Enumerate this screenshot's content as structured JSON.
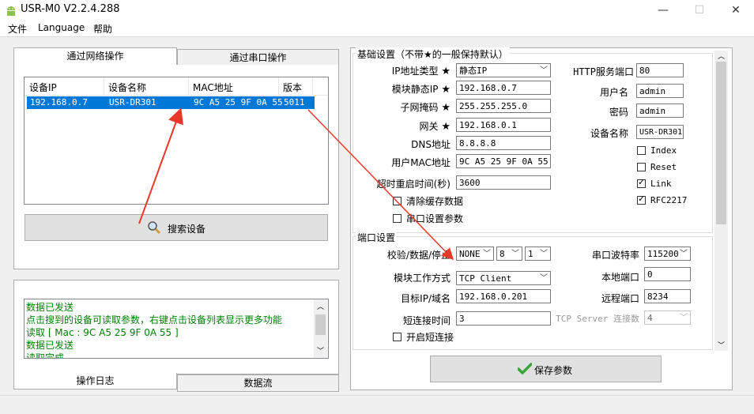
{
  "window": {
    "title": "USR-M0 V2.2.4.288",
    "icon": "android-robot-icon",
    "controls": [
      "minimize-icon",
      "maximize-icon",
      "close-icon"
    ]
  },
  "menu": {
    "items": [
      "文件",
      "Language",
      "帮助"
    ]
  },
  "left": {
    "tabs": {
      "network": "通过网络操作",
      "serial": "通过串口操作"
    },
    "table": {
      "headers": [
        "设备IP",
        "设备名称",
        "MAC地址",
        "版本"
      ],
      "rows": [
        {
          "ip": "192.168.0.7",
          "name": "USR-DR301",
          "mac": "9C A5 25 9F 0A 55",
          "version": "5011"
        }
      ]
    },
    "search_button": "搜索设备",
    "log": {
      "lines": [
        "数据已发送",
        "点击搜到的设备可读取参数，右键点击设备列表显示更多功能",
        "读取 [ Mac : 9C A5 25 9F 0A 55 ]",
        "数据已发送",
        "读取完成"
      ],
      "color": "#008000"
    },
    "bottom_tabs": {
      "log": "操作日志",
      "stream": "数据流"
    }
  },
  "basic": {
    "group_title": "基础设置（不带★的一般保持默认）",
    "ip_type_label": "IP地址类型",
    "ip_type_value": "静态IP",
    "static_ip_label": "模块静态IP",
    "static_ip_value": "192.168.0.7",
    "mask_label": "子网掩码",
    "mask_value": "255.255.255.0",
    "gateway_label": "网关",
    "gateway_value": "192.168.0.1",
    "dns_label": "DNS地址",
    "dns_value": "8.8.8.8",
    "mac_label": "用户MAC地址",
    "mac_value": "9C A5 25 9F 0A 55",
    "timeout_label": "超时重启时间(秒)",
    "timeout_value": "3600",
    "clear_cache_label": "清除缓存数据",
    "serial_params_label": "串口设置参数",
    "http_port_label": "HTTP服务端口",
    "http_port_value": "80",
    "username_label": "用户名",
    "username_value": "admin",
    "password_label": "密码",
    "password_value": "admin",
    "devname_label": "设备名称",
    "devname_value": "USR-DR301",
    "index_label": "Index",
    "reset_label": "Reset",
    "link_label": "Link",
    "rfc_label": "RFC2217",
    "star": "★"
  },
  "port": {
    "group_title": "端口设置",
    "parity_label": "校验/数据/停止",
    "parity_value": "NONE",
    "data_bits": "8",
    "stop_bits": "1",
    "baud_label": "串口波特率",
    "baud_value": "115200",
    "mode_label": "模块工作方式",
    "mode_value": "TCP Client",
    "local_port_label": "本地端口",
    "local_port_value": "0",
    "target_label": "目标IP/域名",
    "target_value": "192.168.0.201",
    "remote_port_label": "远程端口",
    "remote_port_value": "8234",
    "short_conn_label": "短连接时间",
    "short_conn_value": "3",
    "tcp_server_label": "TCP Server 连接数",
    "tcp_server_value": "4",
    "enable_short_label": "开启短连接"
  },
  "save_button": "保存参数",
  "annotation_color": "#e8392b"
}
